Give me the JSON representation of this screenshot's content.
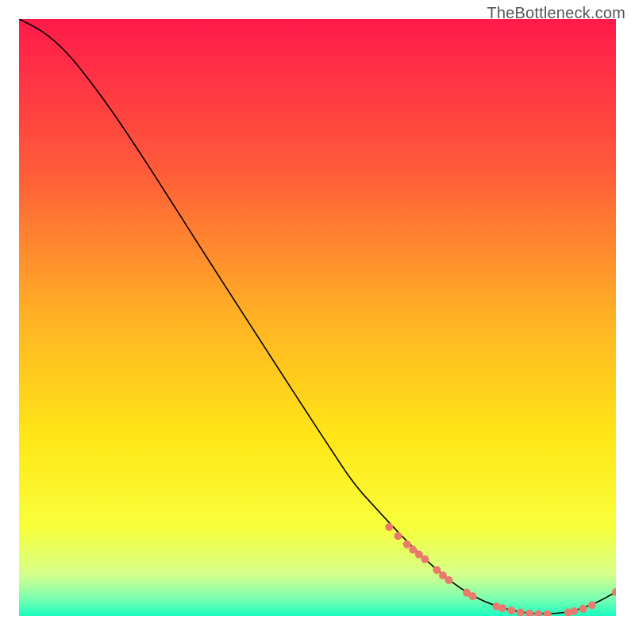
{
  "watermark": "TheBottleneck.com",
  "chart_data": {
    "type": "line",
    "title": "",
    "xlabel": "",
    "ylabel": "",
    "xlim": [
      0,
      100
    ],
    "ylim": [
      0,
      100
    ],
    "axes_visible": false,
    "grid": false,
    "legend": false,
    "background_gradient_stops": [
      {
        "offset": 0.0,
        "color": "#ff1a4b"
      },
      {
        "offset": 0.25,
        "color": "#ff5a3a"
      },
      {
        "offset": 0.5,
        "color": "#ffb224"
      },
      {
        "offset": 0.7,
        "color": "#ffe617"
      },
      {
        "offset": 0.85,
        "color": "#f8ff3a"
      },
      {
        "offset": 0.93,
        "color": "#d6ff8a"
      },
      {
        "offset": 0.97,
        "color": "#7dffb0"
      },
      {
        "offset": 1.0,
        "color": "#1bfcc0"
      }
    ],
    "curve": {
      "name": "bottleneck",
      "x": [
        0,
        4,
        8,
        12,
        16,
        20,
        24,
        28,
        32,
        36,
        40,
        44,
        48,
        52,
        56,
        60,
        64,
        68,
        72,
        76,
        80,
        84,
        88,
        92,
        96,
        100
      ],
      "y": [
        100,
        98,
        94.5,
        89.5,
        84,
        78,
        71.8,
        65.5,
        59.2,
        53,
        46.8,
        40.6,
        34.4,
        28.3,
        22.2,
        17.8,
        13.5,
        9.5,
        6,
        3.3,
        1.6,
        0.6,
        0.3,
        0.6,
        1.8,
        4.0
      ]
    },
    "markers": {
      "name": "highlighted-points",
      "color": "#ea7a6d",
      "radius": 5,
      "points": [
        {
          "x": 62,
          "y": 14.9
        },
        {
          "x": 63.5,
          "y": 13.4
        },
        {
          "x": 65,
          "y": 12.0
        },
        {
          "x": 66,
          "y": 11.1
        },
        {
          "x": 67,
          "y": 10.3
        },
        {
          "x": 68,
          "y": 9.5
        },
        {
          "x": 70,
          "y": 7.7
        },
        {
          "x": 71,
          "y": 6.8
        },
        {
          "x": 72,
          "y": 6.0
        },
        {
          "x": 75,
          "y": 3.9
        },
        {
          "x": 76,
          "y": 3.3
        },
        {
          "x": 80,
          "y": 1.6
        },
        {
          "x": 81,
          "y": 1.3
        },
        {
          "x": 82.5,
          "y": 0.9
        },
        {
          "x": 84,
          "y": 0.6
        },
        {
          "x": 85.5,
          "y": 0.4
        },
        {
          "x": 87,
          "y": 0.3
        },
        {
          "x": 88.5,
          "y": 0.3
        },
        {
          "x": 92,
          "y": 0.6
        },
        {
          "x": 93,
          "y": 0.8
        },
        {
          "x": 94.5,
          "y": 1.2
        },
        {
          "x": 96,
          "y": 1.8
        },
        {
          "x": 100,
          "y": 4.0
        }
      ]
    }
  }
}
